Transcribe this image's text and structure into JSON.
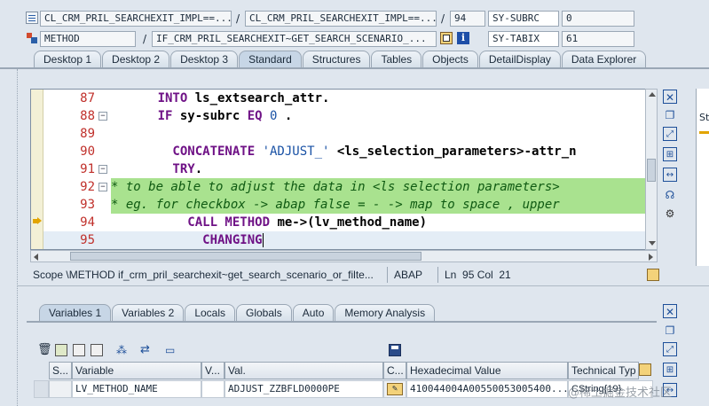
{
  "header": {
    "row1": {
      "program": "CL_CRM_PRIL_SEARCHEXIT_IMPL==...",
      "include": "CL_CRM_PRIL_SEARCHEXIT_IMPL==...",
      "line": "94",
      "sysvar_name": "SY-SUBRC",
      "sysvar_value": "0"
    },
    "row2": {
      "type": "METHOD",
      "event": "IF_CRM_PRIL_SEARCHEXIT~GET_SEARCH_SCENARIO_...",
      "sysvar_name": "SY-TABIX",
      "sysvar_value": "61"
    },
    "slash": "/"
  },
  "main_tabs": [
    "Desktop 1",
    "Desktop 2",
    "Desktop 3",
    "Standard",
    "Structures",
    "Tables",
    "Objects",
    "DetailDisplay",
    "Data Explorer"
  ],
  "main_tab_active": "Standard",
  "code_lines": [
    {
      "n": "87",
      "fold": "",
      "parts": [
        [
          "kw",
          "      INTO "
        ],
        [
          "id",
          "ls_extsearch_attr"
        ],
        [
          "id",
          "."
        ]
      ]
    },
    {
      "n": "88",
      "fold": "−",
      "parts": [
        [
          "kw",
          "      IF "
        ],
        [
          "id",
          "sy-subrc "
        ],
        [
          "kw",
          "EQ "
        ],
        [
          "str",
          "0"
        ],
        [
          "id",
          " ."
        ]
      ]
    },
    {
      "n": "89",
      "fold": "",
      "parts": []
    },
    {
      "n": "90",
      "fold": "",
      "parts": [
        [
          "kw",
          "        CONCATENATE "
        ],
        [
          "str",
          "'ADJUST_'"
        ],
        [
          "id",
          " <ls_selection_parameters>-attr_n"
        ]
      ]
    },
    {
      "n": "91",
      "fold": "−",
      "parts": [
        [
          "kw",
          "        TRY"
        ],
        [
          "id",
          "."
        ]
      ]
    },
    {
      "n": "92",
      "fold": "−",
      "parts": [
        [
          "cmt",
          "* to be able to adjust the data in <ls selection parameters>"
        ]
      ]
    },
    {
      "n": "93",
      "fold": "",
      "parts": [
        [
          "cmt",
          "* eg. for checkbox -> abap false = - -> map to space , upper"
        ]
      ]
    },
    {
      "n": "94",
      "fold": "",
      "parts": [
        [
          "kw",
          "          CALL METHOD "
        ],
        [
          "id",
          "me->(lv_method_name)"
        ]
      ]
    },
    {
      "n": "95",
      "fold": "",
      "parts": [
        [
          "kw",
          "            CHANGING"
        ]
      ]
    }
  ],
  "status_bar": {
    "scope": "Scope \\METHOD if_crm_pril_searchexit~get_search_scenario_or_filte...",
    "lang": "ABAP",
    "pos": "Ln  95 Col  21"
  },
  "var_tabs": [
    "Variables 1",
    "Variables 2",
    "Locals",
    "Globals",
    "Auto",
    "Memory Analysis"
  ],
  "var_tab_active": "Variables 1",
  "grid": {
    "headers": [
      "S...",
      "Variable",
      "V...",
      "Val.",
      "C...",
      "Hexadecimal Value",
      "Technical Typ"
    ],
    "row": {
      "variable": "LV_METHOD_NAME",
      "value": "ADJUST_ZZBFLD0000PE",
      "hex": "410044004A00550053005400...",
      "type": "CString{19}"
    }
  },
  "watermark": "@稀土掘金技术社区"
}
